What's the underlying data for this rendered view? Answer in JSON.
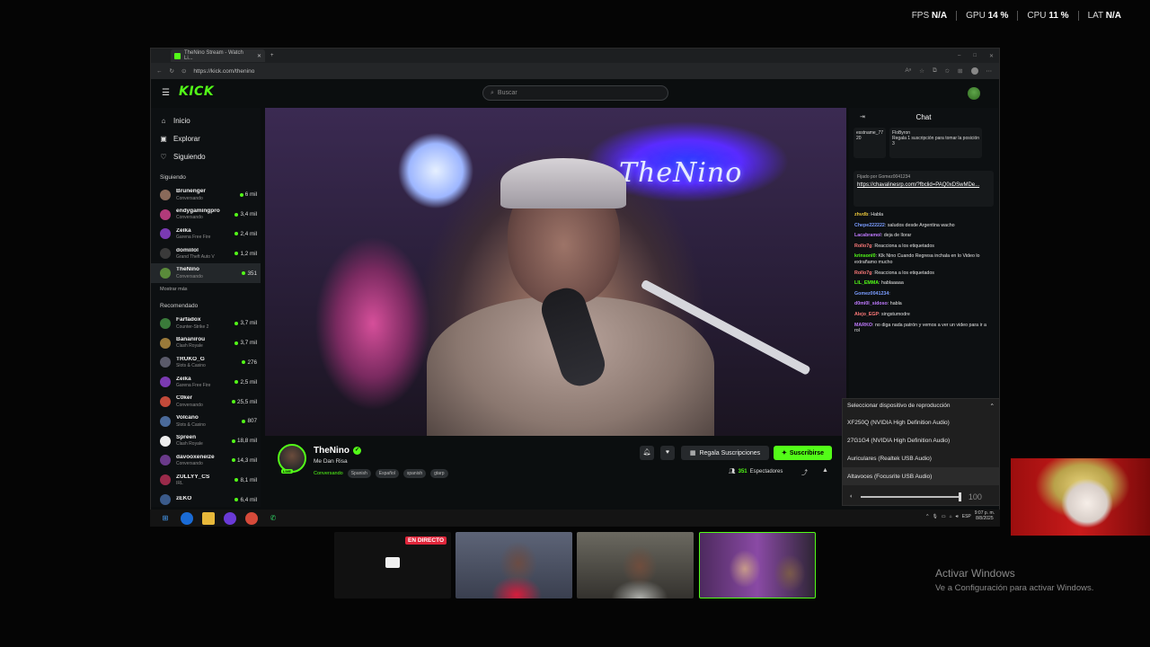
{
  "stats": [
    {
      "label": "FPS",
      "value": "N/A"
    },
    {
      "label": "GPU",
      "value": "14 %"
    },
    {
      "label": "CPU",
      "value": "11 %"
    },
    {
      "label": "LAT",
      "value": "N/A"
    }
  ],
  "browser": {
    "tab_title": "TheNino Stream - Watch Li...",
    "url": "https://kick.com/thenino"
  },
  "kick": {
    "logo": "KICK",
    "search_placeholder": "Buscar"
  },
  "nav": [
    {
      "icon": "home-icon",
      "glyph": "⌂",
      "label": "Inicio"
    },
    {
      "icon": "browse-icon",
      "glyph": "▣",
      "label": "Explorar"
    },
    {
      "icon": "heart-icon",
      "glyph": "♡",
      "label": "Siguiendo"
    }
  ],
  "sidebar": {
    "following_header": "Siguiendo",
    "following": [
      {
        "name": "Brunenger",
        "category": "Conversando",
        "viewers": "6 mil",
        "color": "#8a6a5a"
      },
      {
        "name": "endygamingpro",
        "category": "Conversando",
        "viewers": "3,4 mil",
        "color": "#b23a7a"
      },
      {
        "name": "Zeika",
        "category": "Garena Free Fire",
        "viewers": "2,4 mil",
        "color": "#7a3ab2"
      },
      {
        "name": "domiilol",
        "category": "Grand Theft Auto V",
        "viewers": "1,2 mil",
        "color": "#3a3a3a"
      },
      {
        "name": "TheNino",
        "category": "Conversando",
        "viewers": "351",
        "color": "#5a8a3a"
      }
    ],
    "show_more": "Mostrar más",
    "recommended_header": "Recomendado",
    "recommended": [
      {
        "name": "Farfadox",
        "category": "Counter-Strike 2",
        "viewers": "3,7 mil",
        "color": "#3a7a3a"
      },
      {
        "name": "Bananirou",
        "category": "Clash Royale",
        "viewers": "3,7 mil",
        "color": "#9a7a3a"
      },
      {
        "name": "TRUKO_G",
        "category": "Slots & Casino",
        "viewers": "276",
        "color": "#5a5a6a"
      },
      {
        "name": "Zeika",
        "category": "Garena Free Fire",
        "viewers": "2,5 mil",
        "color": "#7a3ab2"
      },
      {
        "name": "C0ker",
        "category": "Conversando",
        "viewers": "25,5 mil",
        "color": "#c24a3a"
      },
      {
        "name": "Volcano",
        "category": "Slots & Casino",
        "viewers": "807",
        "color": "#4a6a9a"
      },
      {
        "name": "Spreen",
        "category": "Clash Royale",
        "viewers": "18,8 mil",
        "color": "#eeeeee"
      },
      {
        "name": "davooxeneize",
        "category": "Conversando",
        "viewers": "14,3 mil",
        "color": "#6a3a8a"
      },
      {
        "name": "ZULLYY_CS",
        "category": "IRL",
        "viewers": "8,1 mil",
        "color": "#9a2a4a"
      },
      {
        "name": "zEKO",
        "category": "",
        "viewers": "6,4 mil",
        "color": "#3a5a8a"
      }
    ]
  },
  "video": {
    "neon_text": "TheNino"
  },
  "stream": {
    "streamer": "TheNino",
    "live_tag": "LIVE",
    "title": "Me Dan Risa",
    "category": "Conversando",
    "tags": [
      "Spanish",
      "Español",
      "spanish",
      "gtarp"
    ],
    "gift_label": "Regala Suscripciones",
    "subscribe_label": "Suscribirse",
    "viewers": "351",
    "viewers_label": "Espectadores"
  },
  "chat": {
    "title": "Chat",
    "top_cards": [
      {
        "user": "esstname_77",
        "value": "20"
      },
      {
        "user": "FloByron",
        "text": "Regala 1 suscripción para tomar la posición",
        "value": "3"
      }
    ],
    "pinned_by": "Fijado por  Gomez0041234",
    "pinned_link": "https://chavalinesrp.com/?fbclid=PAQ0xDSwMDe...",
    "messages": [
      {
        "user": "zhvdb",
        "color": "#e8c43a",
        "text": "Habla"
      },
      {
        "user": "Chepe222222",
        "color": "#7a9cff",
        "text": "saludos desde Argentina wacho"
      },
      {
        "user": "Lacabramol",
        "color": "#c07aff",
        "text": "deja de llorar"
      },
      {
        "user": "Rollo7g",
        "color": "#ff7a7a",
        "text": "Reacciona a los etiquetados"
      },
      {
        "user": "krinsonl0",
        "color": "#53fc18",
        "text": "Klk Nino Cuando Regresa inchala en lo Video lo extrañamo mucho"
      },
      {
        "user": "Rollo7g",
        "color": "#ff7a7a",
        "text": "Reacciona a los etiquetados"
      },
      {
        "user": "LIL_EMMA",
        "color": "#53fc18",
        "text": "hablaaaaa"
      },
      {
        "user": "Gomez0041234",
        "color": "#7a9cff",
        "text": ""
      },
      {
        "user": "d0mi0l_sidoso",
        "color": "#c07aff",
        "text": "habla"
      },
      {
        "user": "Alejo_EGP",
        "color": "#ff7a7a",
        "text": "singstumodre"
      },
      {
        "user": "MARKO",
        "color": "#c07aff",
        "text": "no diga nada patrón y vemos a ver un video para ir a rol"
      }
    ]
  },
  "audio_menu": {
    "title": "Seleccionar dispositivo de reproducción",
    "options": [
      "XF250Q (NVIDIA High Definition Audio)",
      "27G1G4 (NVIDIA High Definition Audio)",
      "Auriculares (Realtek USB Audio)",
      "Altavoces (Focusrite USB Audio)"
    ],
    "volume": "100",
    "volume_fraction": 1.0
  },
  "taskbar": {
    "lang": "ESP",
    "time": "9:07 p. m.",
    "date": "8/8/2025"
  },
  "thumbnails": {
    "live_badge": "EN DIRECTO"
  },
  "watermark": {
    "line1": "Activar Windows",
    "line2": "Ve a Configuración para activar Windows."
  }
}
